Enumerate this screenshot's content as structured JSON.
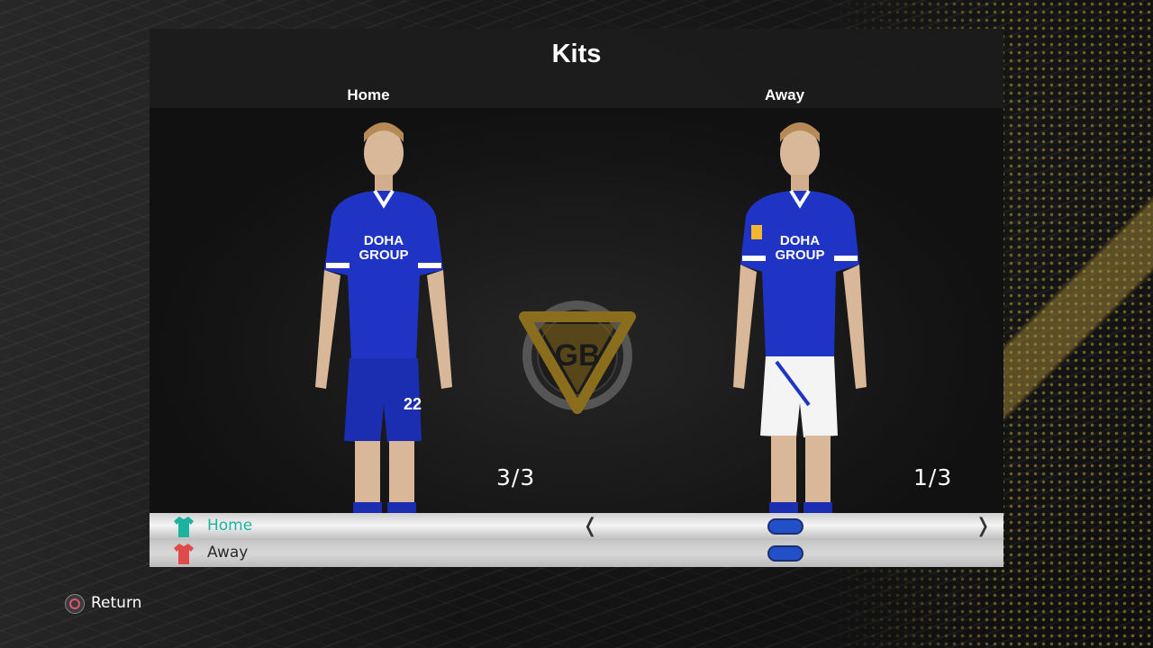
{
  "title": "Kits",
  "columns": {
    "home": "Home",
    "away": "Away"
  },
  "counters": {
    "home": "3/3",
    "away": "1/3"
  },
  "player_home": {
    "shirt_text": "DOHA\nGROUP",
    "shirt_line1": "DOHA",
    "shirt_line2": "GROUP",
    "shorts_number": "22"
  },
  "player_away": {
    "shirt_line1": "DOHA",
    "shirt_line2": "GROUP"
  },
  "kit_list": [
    {
      "label": "Home",
      "icon": "green-shirt-icon",
      "icon_color": "#1db2a0",
      "selected": true
    },
    {
      "label": "Away",
      "icon": "red-shirt-icon",
      "icon_color": "#e04a4a",
      "selected": false
    }
  ],
  "footer": {
    "return_label": "Return",
    "button_icon": "circle-button-icon"
  },
  "colors": {
    "kit_blue": "#1f33c4",
    "accent_gold": "#b49a3a",
    "toggle_blue": "#2350c8"
  }
}
